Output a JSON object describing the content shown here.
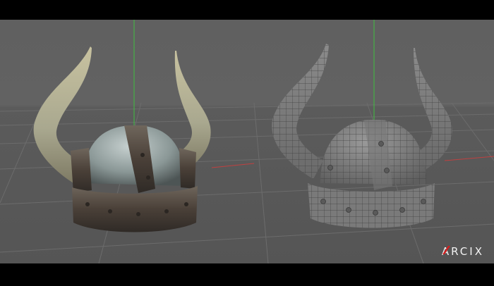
{
  "scene": {
    "background_color": "#5c5c5c",
    "grid_color": "#6c6c6c",
    "left_model": {
      "name": "viking-helmet-textured",
      "style": "textured"
    },
    "right_model": {
      "name": "viking-helmet-wireframe",
      "style": "wireframe"
    }
  },
  "watermark": {
    "text": "ARCIX",
    "accent_color": "#d11f1f",
    "icon": "slash-logo-icon"
  }
}
